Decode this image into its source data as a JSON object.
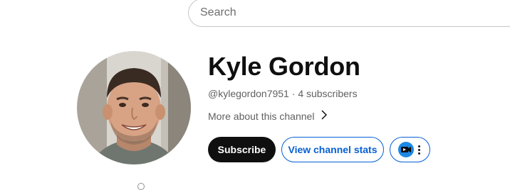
{
  "search": {
    "placeholder": "Search",
    "value": ""
  },
  "channel": {
    "name": "Kyle Gordon",
    "handle": "@kylegordon7951",
    "separator": " · ",
    "subscribers": "4 subscribers",
    "more_label": "More about this channel"
  },
  "actions": {
    "subscribe_label": "Subscribe",
    "stats_label": "View channel stats",
    "extension_icon": "extension-logo-icon",
    "menu_icon": "more-vert-icon"
  },
  "colors": {
    "subscribe_bg": "#0f0f0f",
    "accent_blue": "#065fd4",
    "secondary_text": "#606060"
  }
}
